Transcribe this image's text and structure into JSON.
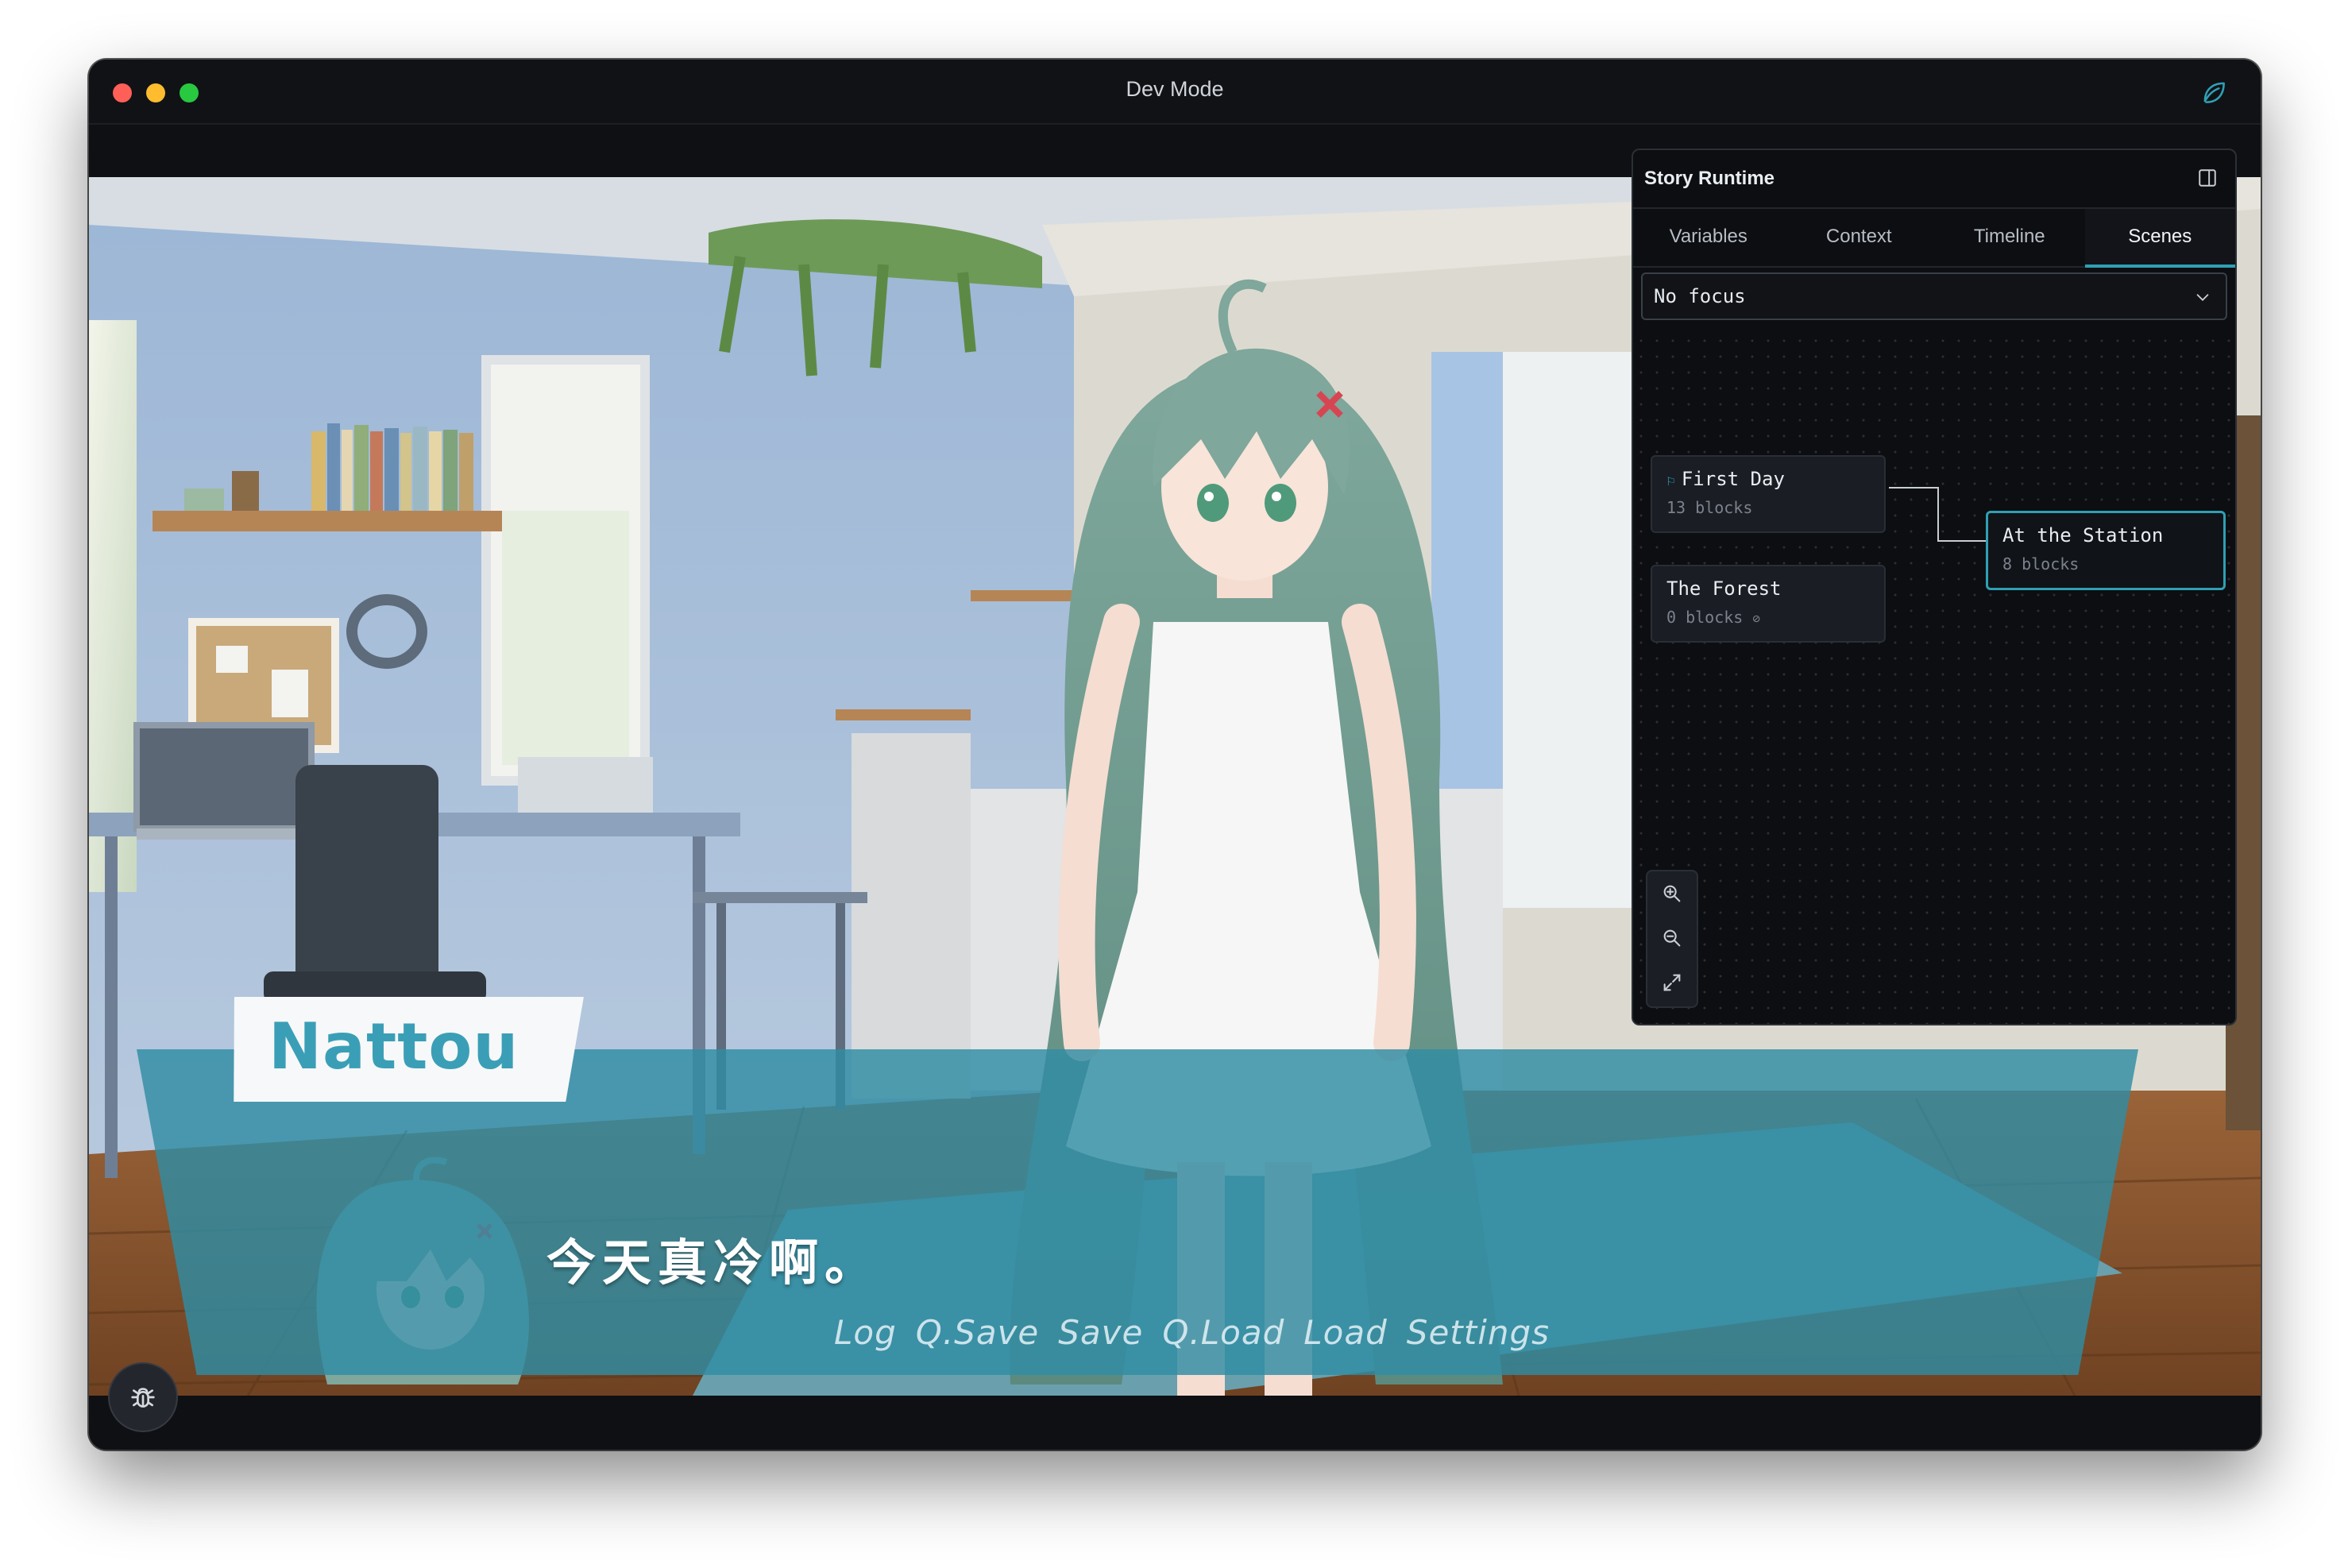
{
  "window": {
    "title": "Dev Mode"
  },
  "game": {
    "speaker": "Nattou",
    "dialogue": "今天真冷啊。",
    "menu": [
      "Log",
      "Q.Save",
      "Save",
      "Q.Load",
      "Load",
      "Settings"
    ]
  },
  "panel": {
    "title": "Story Runtime",
    "tabs": [
      {
        "label": "Variables",
        "active": false
      },
      {
        "label": "Context",
        "active": false
      },
      {
        "label": "Timeline",
        "active": false
      },
      {
        "label": "Scenes",
        "active": true
      }
    ],
    "focus_select": "No focus",
    "scenes": [
      {
        "name": "First Day",
        "blocks": "13 blocks",
        "entry": true
      },
      {
        "name": "The Forest",
        "blocks": "0 blocks",
        "entry": false
      },
      {
        "name": "At the Station",
        "blocks": "8 blocks",
        "entry": false,
        "focused": true
      }
    ]
  },
  "colors": {
    "accent": "#2fa0b4",
    "textbox": "#2f8ca4",
    "name_color": "#3a9fb6"
  }
}
